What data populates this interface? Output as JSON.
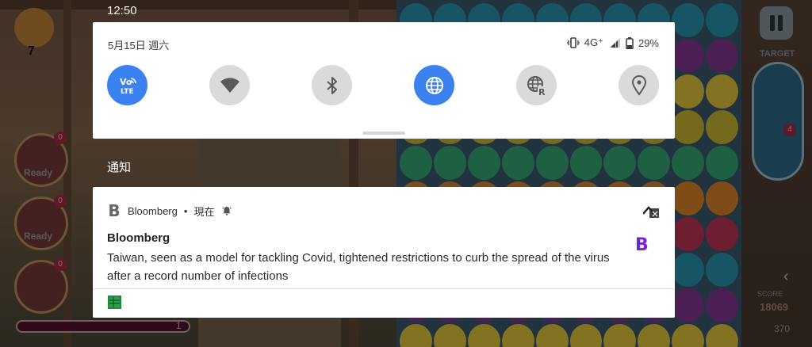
{
  "status_bar": {
    "time": "12:50"
  },
  "quick_settings": {
    "date": "5月15日 週六",
    "network": "4G⁺",
    "battery": "29%",
    "tiles": [
      {
        "name": "volte",
        "label": "LTE",
        "state": "on"
      },
      {
        "name": "wifi",
        "state": "off"
      },
      {
        "name": "bluetooth",
        "state": "off"
      },
      {
        "name": "data",
        "state": "on"
      },
      {
        "name": "roaming",
        "state": "off"
      },
      {
        "name": "location",
        "state": "off"
      }
    ]
  },
  "shade": {
    "title": "通知"
  },
  "notification": {
    "app_name": "Bloomberg",
    "separator": "•",
    "time": "現在",
    "title": "Bloomberg",
    "body": "Taiwan, seen as a model for tackling Covid, tightened restrictions to curb the spread of the virus after a record number of infections",
    "app_icon_letter": "B",
    "thumb_letter": "B"
  },
  "game": {
    "left_count": "7",
    "ready_label": "Ready",
    "zero_badge": "0",
    "hp_value": "1",
    "target_label": "TARGET",
    "target_count": "4",
    "score_label": "SCORE",
    "score": "18069",
    "coins": "370"
  },
  "colors": {
    "accent": "#3b82f0",
    "tile_off": "#dadada",
    "panel": "#ffffff"
  }
}
